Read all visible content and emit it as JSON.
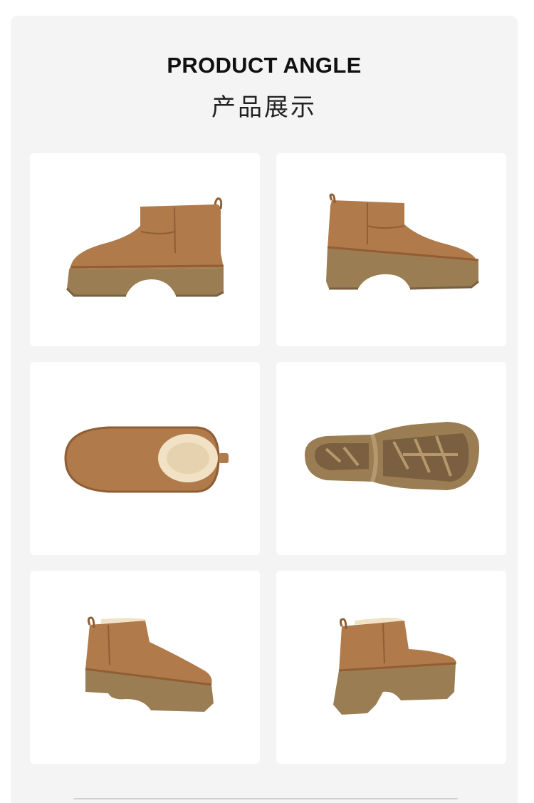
{
  "header": {
    "title_en": "PRODUCT ANGLE",
    "title_zh": "产品展示"
  },
  "gallery": {
    "views": [
      {
        "icon": "boot-side-left-icon"
      },
      {
        "icon": "boot-side-right-icon"
      },
      {
        "icon": "boot-top-view-icon"
      },
      {
        "icon": "boot-sole-icon"
      },
      {
        "icon": "boot-front-three-quarter-icon"
      },
      {
        "icon": "boot-back-three-quarter-icon"
      }
    ]
  },
  "colors": {
    "suede": "#b07a4a",
    "suede_dark": "#8f5e35",
    "sole": "#9a7d52",
    "sole_dark": "#7a6040",
    "fur": "#f1e2c6",
    "panel_bg": "#f4f4f4"
  }
}
